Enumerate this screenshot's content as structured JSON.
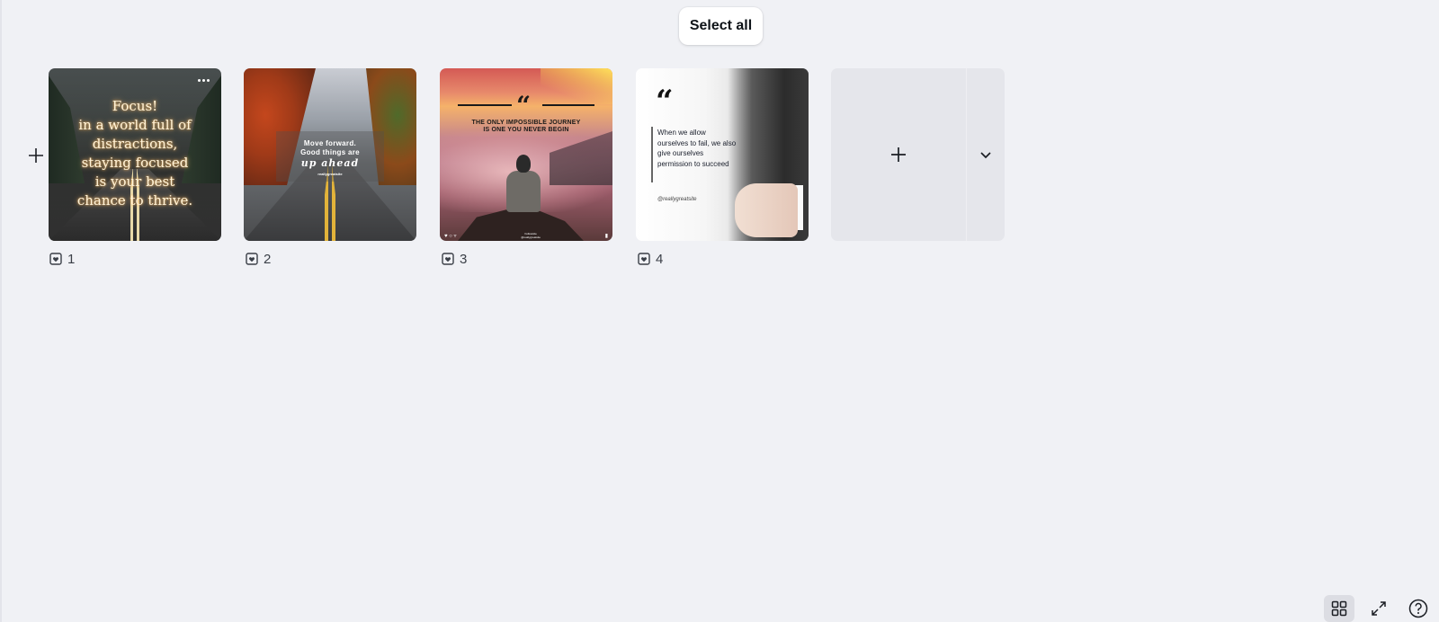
{
  "toolbar": {
    "select_all_label": "Select all"
  },
  "pages": [
    {
      "number": "1",
      "quote_lines": [
        "Focus!",
        "in a world full of",
        "distractions,",
        "staying focused",
        "is your best",
        "chance to thrive."
      ]
    },
    {
      "number": "2",
      "line1": "Move forward.",
      "line2": "Good things are",
      "script": "up ahead",
      "handle": "reallygreatsite"
    },
    {
      "number": "3",
      "title_line1": "THE ONLY IMPOSSIBLE JOURNEY",
      "title_line2": "IS ONE YOU NEVER BEGIN",
      "footer_name": "Followsite",
      "footer_handle": "@reallygreatsite"
    },
    {
      "number": "4",
      "quote": "When we allow ourselves to fail, we also give ourselves permission to succeed",
      "handle": "@reallygreatsite"
    }
  ],
  "icons": {
    "insert": "plus-icon",
    "more": "more-options-icon",
    "notes": "notes-icon",
    "add_page": "plus-icon",
    "dropdown": "chevron-down-icon",
    "grid": "grid-view-icon",
    "fullscreen": "expand-icon",
    "help": "help-icon"
  },
  "colors": {
    "background": "#f0f1f5",
    "add_page_bg": "#e5e6eb"
  }
}
